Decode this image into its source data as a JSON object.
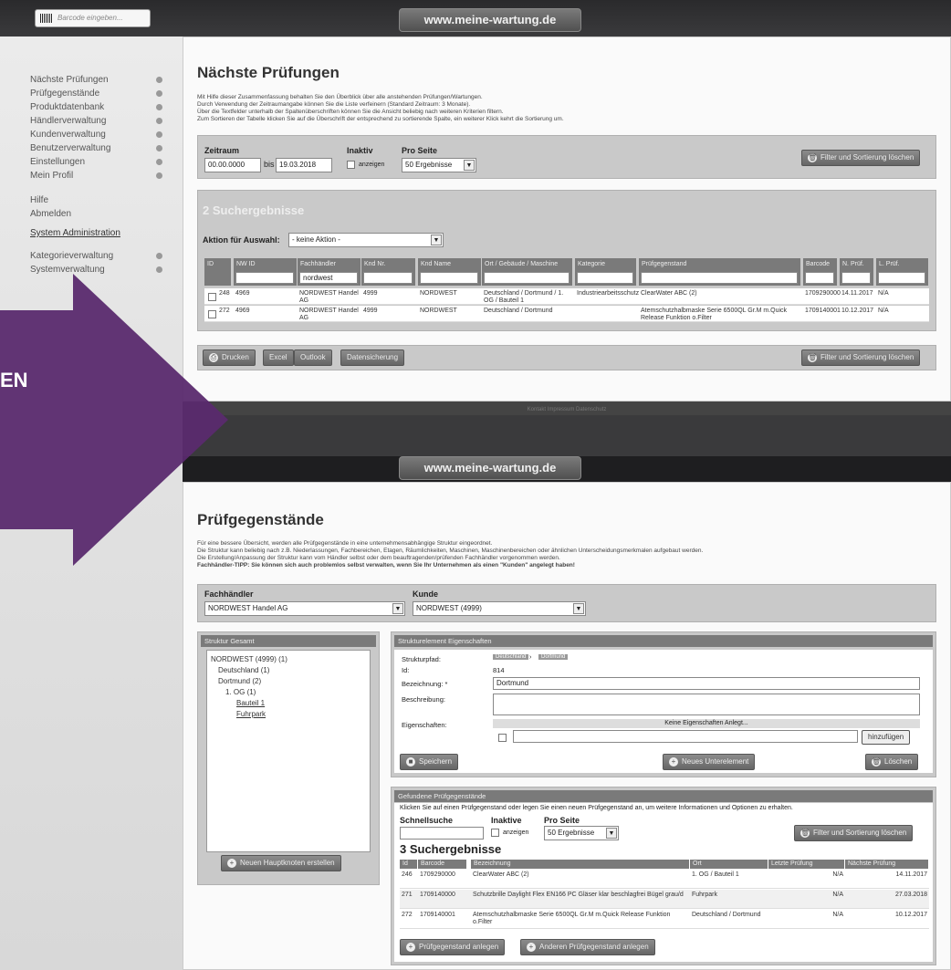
{
  "url": "www.meine-wartung.de",
  "barcode_placeholder": "Barcode eingeben...",
  "arrow_text": "EN",
  "nav": {
    "items": [
      "Nächste Prüfungen",
      "Prüfgegenstände",
      "Produktdatenbank",
      "Händlerverwaltung",
      "Kundenverwaltung",
      "Benutzerverwaltung",
      "Einstellungen",
      "Mein Profil"
    ],
    "help": "Hilfe",
    "logout": "Abmelden",
    "sysadmin": "System Administration",
    "admin_items": [
      "Kategorieverwaltung",
      "Systemverwaltung"
    ]
  },
  "top": {
    "title": "Nächste Prüfungen",
    "desc": [
      "Mit Hilfe dieser Zusammenfassung behalten Sie den Überblick über alle anstehenden Prüfungen/Wartungen.",
      "Durch Verwendung der Zeitraumangabe können Sie die Liste verfeinern (Standard Zeitraum: 3 Monate).",
      "Über die Textfelder unterhalb der Spaltenüberschriften können Sie die Ansicht beliebig nach weiteren Kriterien filtern.",
      "Zum Sortieren der Tabelle klicken Sie auf die Überschrift der entsprechend zu sortierende Spalte, ein weiterer Klick kehrt die Sortierung um."
    ],
    "zeitraum_label": "Zeitraum",
    "from": "00.00.0000",
    "bis": "bis",
    "to": "19.03.2018",
    "inaktiv_label": "Inaktiv",
    "anzeigen": "anzeigen",
    "proseite_label": "Pro Seite",
    "proseite_value": "50 Ergebnisse",
    "clear_btn": "Filter und Sortierung löschen",
    "results": "2 Suchergebnisse",
    "aktion_label": "Aktion für Auswahl:",
    "aktion_value": "- keine Aktion -",
    "columns": [
      "ID",
      "NW ID",
      "Fachhändler",
      "Knd Nr.",
      "Knd Name",
      "Ort / Gebäude / Maschine",
      "Kategorie",
      "Prüfgegenstand",
      "Barcode",
      "N. Prüf.",
      "L. Prüf."
    ],
    "filter_value": "nordwest",
    "rows": [
      [
        "248",
        "4969",
        "NORDWEST Handel AG",
        "4999",
        "NORDWEST",
        "Deutschland / Dortmund / 1. OG / Bauteil 1",
        "Industriearbeitsschutz",
        "ClearWater ABC (2)",
        "1709290000",
        "14.11.2017",
        "N/A"
      ],
      [
        "272",
        "4969",
        "NORDWEST Handel AG",
        "4999",
        "NORDWEST",
        "Deutschland / Dortmund",
        "",
        "Atemschutzhalbmaske Serie 6500QL Gr.M m.Quick Release Funktion o.Filter",
        "1709140001",
        "10.12.2017",
        "N/A"
      ]
    ],
    "btns": [
      "Drucken",
      "Excel",
      "Outlook",
      "Datensicherung"
    ],
    "footer": "Kontakt  Impressum  Datenschutz"
  },
  "bottom": {
    "title": "Prüfgegenstände",
    "desc": [
      "Für eine bessere Übersicht, werden alle Prüfgegenstände in eine unternehmensabhängige Struktur eingeordnet.",
      "Die Struktur kann beliebig nach z.B. Niederlassungen, Fachbereichen, Etagen, Räumlichkeiten, Maschinen, Maschinenbereichen oder ähnlichen Unterscheidungsmerkmalen aufgebaut werden.",
      "Die Erstellung/Anpassung der Struktur kann vom Händler selbst oder dem beauftragenden/prüfenden Fachhändler vorgenommen werden.",
      "Fachhändler-TIPP: Sie können sich auch problemlos selbst verwalten, wenn Sie Ihr Unternehmen als einen \"Kunden\" angelegt haben!"
    ],
    "fachhaendler_label": "Fachhändler",
    "fachhaendler_value": "NORDWEST Handel AG",
    "kunde_label": "Kunde",
    "kunde_value": "NORDWEST (4999)",
    "struktur_title": "Struktur Gesamt",
    "tree": [
      "NORDWEST (4999) (1)",
      "Deutschland (1)",
      "Dortmund (2)",
      "1. OG (1)",
      "Bauteil 1",
      "Fuhrpark"
    ],
    "new_main_btn": "Neuen Hauptknoten erstellen",
    "props_title": "Strukturelement Eigenschaften",
    "pfad_label": "Strukturpfad:",
    "pfad": [
      "Deutschland",
      "Dortmund"
    ],
    "id_label": "Id:",
    "id_value": "814",
    "bez_label": "Bezeichnung: *",
    "bez_value": "Dortmund",
    "beschr_label": "Beschreibung:",
    "eig_label": "Eigenschaften:",
    "eig_empty": "Keine Eigenschaften Anlegt...",
    "hinzu_btn": "hinzufügen",
    "save_btn": "Speichern",
    "new_sub_btn": "Neues Unterelement",
    "delete_btn": "Löschen",
    "found_title": "Gefundene Prüfgegenstände",
    "found_desc": "Klicken Sie auf einen Prüfgegenstand oder legen Sie einen neuen Prüfgegenstand an, um weitere Informationen und Optionen zu erhalten.",
    "schnell_label": "Schnellsuche",
    "inaktive_label": "Inaktive",
    "anzeigen": "anzeigen",
    "proseite_label": "Pro Seite",
    "proseite_value": "50 Ergebnisse",
    "clear_btn": "Filter und Sortierung löschen",
    "results": "3 Suchergebnisse",
    "columns": [
      "Id",
      "Barcode",
      "Bezeichnung",
      "Ort",
      "Letzte Prüfung",
      "Nächste Prüfung"
    ],
    "rows": [
      [
        "246",
        "1709290000",
        "ClearWater ABC (2)",
        "1. OG / Bauteil 1",
        "N/A",
        "14.11.2017"
      ],
      [
        "271",
        "1709140000",
        "Schutzbrille Daylight Flex EN166 PC Gläser klar beschlagfrei Bügel grau/d",
        "Fuhrpark",
        "N/A",
        "27.03.2018"
      ],
      [
        "272",
        "1709140001",
        "Atemschutzhalbmaske Serie 6500QL Gr.M m.Quick Release Funktion o.Filter",
        "Deutschland / Dortmund",
        "N/A",
        "10.12.2017"
      ]
    ],
    "add_btn": "Prüfgegenstand anlegen",
    "add_other_btn": "Anderen Prüfgegenstand anlegen"
  }
}
